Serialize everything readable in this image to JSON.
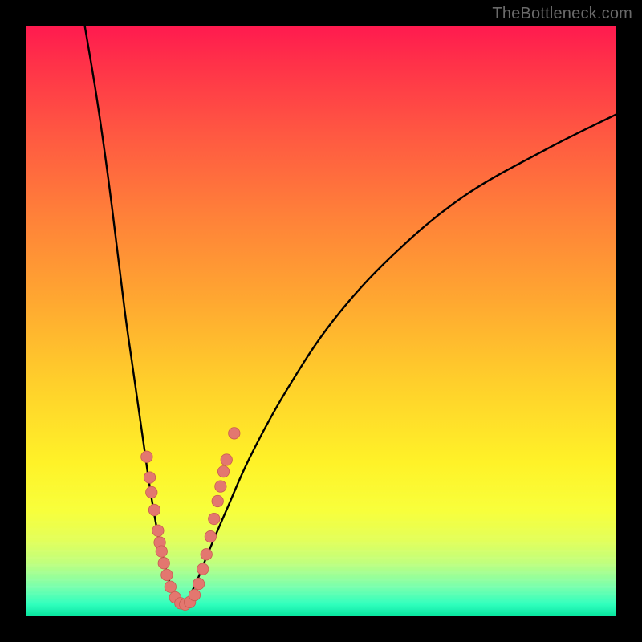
{
  "watermark": "TheBottleneck.com",
  "colors": {
    "curve": "#000000",
    "marker_fill": "#e3776f",
    "marker_stroke": "#c95b52"
  },
  "chart_data": {
    "type": "line",
    "title": "",
    "xlabel": "",
    "ylabel": "",
    "xlim": [
      0,
      100
    ],
    "ylim": [
      0,
      100
    ],
    "note": "No axis ticks or numeric labels are visible; values are estimated from pixel geometry in a 0–100 domain/range.",
    "series": [
      {
        "name": "left-curve",
        "x": [
          10,
          12,
          14,
          16,
          17,
          18,
          19,
          20,
          21,
          22,
          23,
          24,
          25,
          26
        ],
        "y": [
          100,
          88,
          74,
          58,
          50,
          43,
          36,
          29,
          22,
          16,
          11,
          7,
          4,
          2
        ]
      },
      {
        "name": "right-curve",
        "x": [
          27,
          29,
          31,
          34,
          38,
          44,
          52,
          62,
          74,
          88,
          100
        ],
        "y": [
          2,
          6,
          11,
          18,
          27,
          38,
          50,
          61,
          71,
          79,
          85
        ]
      }
    ],
    "markers": {
      "name": "highlighted-points",
      "note": "Salmon dots clustered near the valley bottom on both branches.",
      "points": [
        {
          "x": 20.5,
          "y": 27
        },
        {
          "x": 21.0,
          "y": 23.5
        },
        {
          "x": 21.3,
          "y": 21
        },
        {
          "x": 21.8,
          "y": 18
        },
        {
          "x": 22.4,
          "y": 14.5
        },
        {
          "x": 22.7,
          "y": 12.5
        },
        {
          "x": 23.0,
          "y": 11
        },
        {
          "x": 23.4,
          "y": 9
        },
        {
          "x": 23.9,
          "y": 7
        },
        {
          "x": 24.5,
          "y": 5
        },
        {
          "x": 25.3,
          "y": 3.2
        },
        {
          "x": 26.2,
          "y": 2.2
        },
        {
          "x": 27.0,
          "y": 2.0
        },
        {
          "x": 27.8,
          "y": 2.4
        },
        {
          "x": 28.6,
          "y": 3.6
        },
        {
          "x": 29.3,
          "y": 5.5
        },
        {
          "x": 30.0,
          "y": 8
        },
        {
          "x": 30.6,
          "y": 10.5
        },
        {
          "x": 31.3,
          "y": 13.5
        },
        {
          "x": 31.9,
          "y": 16.5
        },
        {
          "x": 32.5,
          "y": 19.5
        },
        {
          "x": 33.0,
          "y": 22
        },
        {
          "x": 33.5,
          "y": 24.5
        },
        {
          "x": 34.0,
          "y": 26.5
        },
        {
          "x": 35.3,
          "y": 31
        }
      ]
    }
  }
}
